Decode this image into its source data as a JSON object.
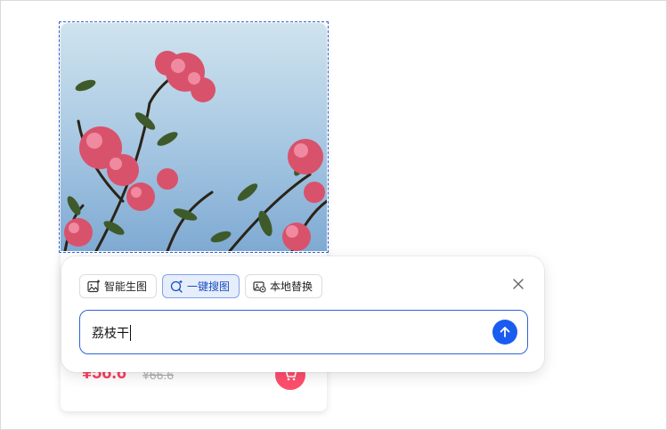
{
  "product": {
    "price_current": "¥56.6",
    "price_original": "¥66.6"
  },
  "ai_panel": {
    "tabs": [
      {
        "label": "智能生图",
        "icon": "image-ai-icon",
        "active": false
      },
      {
        "label": "一键搜图",
        "icon": "search-ai-icon",
        "active": true
      },
      {
        "label": "本地替换",
        "icon": "image-replace-icon",
        "active": false
      }
    ],
    "input_value": "荔枝干"
  },
  "colors": {
    "accent": "#1a5cf0",
    "price": "#ff3b5c",
    "cart": "#ff4d6d"
  }
}
